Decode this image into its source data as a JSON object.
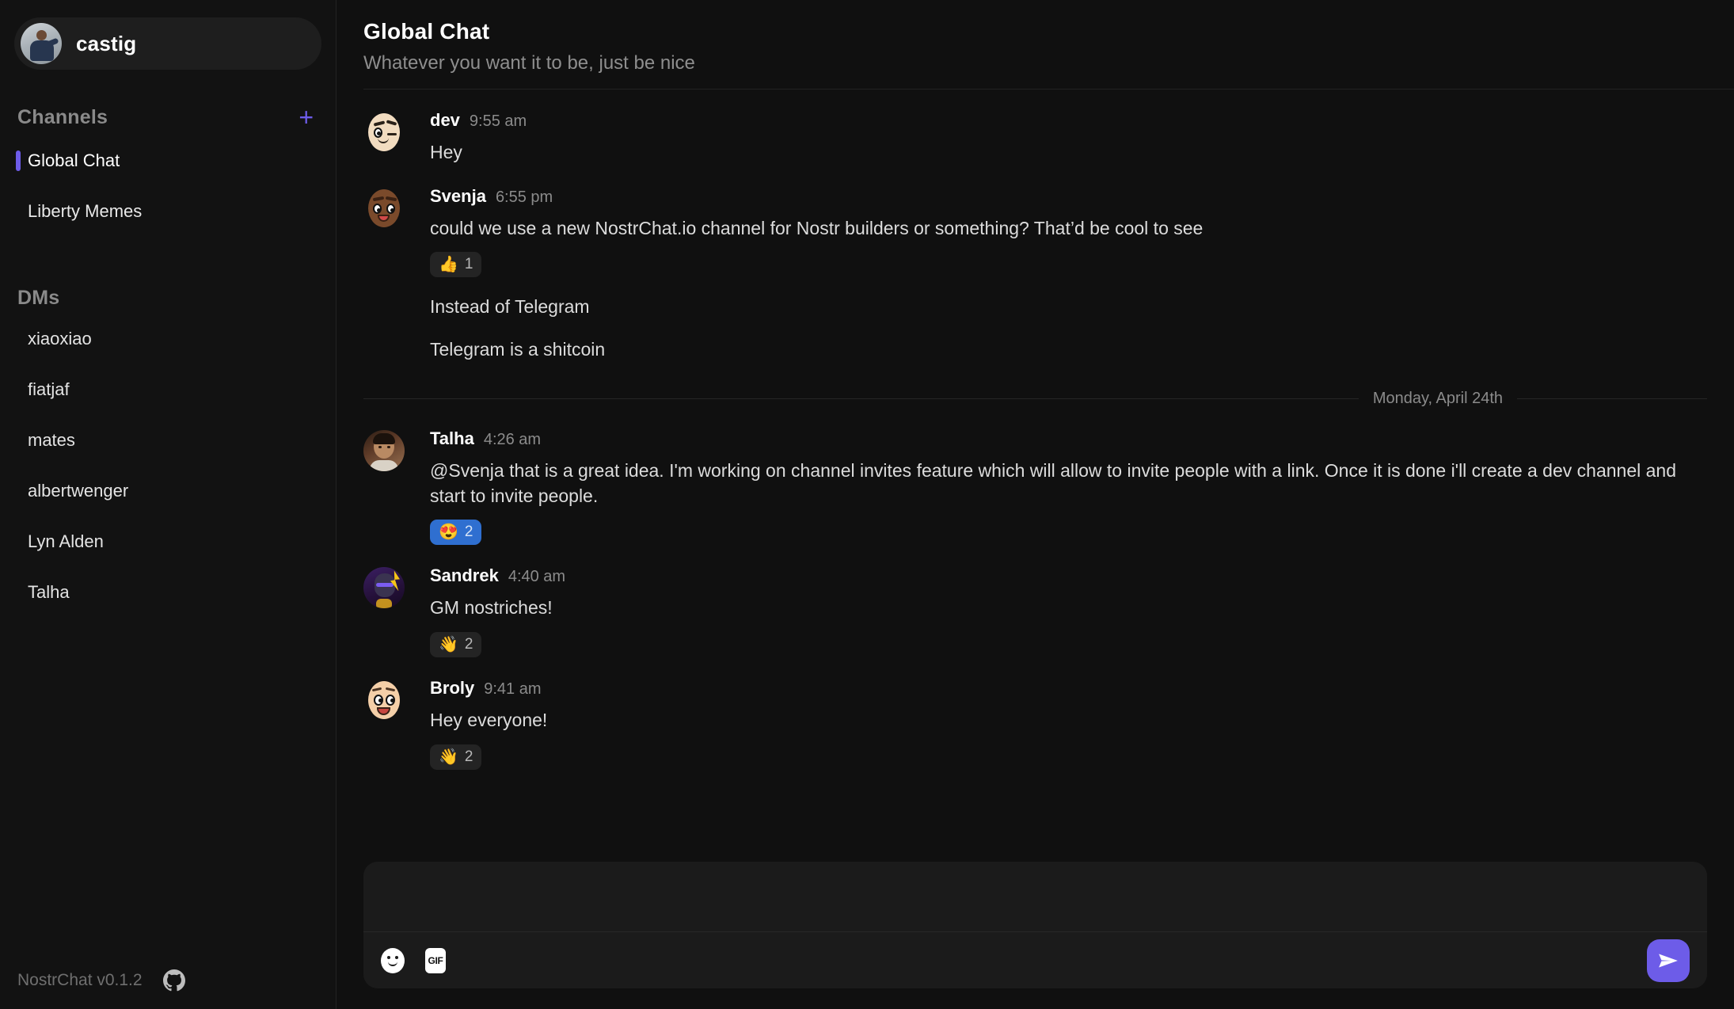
{
  "app": {
    "version_label": "NostrChat v0.1.2",
    "github_icon": "github-icon"
  },
  "sidebar": {
    "profile": {
      "name": "castig",
      "avatar": "user-avatar"
    },
    "channels_section": {
      "title": "Channels",
      "add_label": "+"
    },
    "channels": [
      {
        "label": "Global Chat",
        "active": true
      },
      {
        "label": "Liberty Memes",
        "active": false
      }
    ],
    "dms_section": {
      "title": "DMs"
    },
    "dms": [
      {
        "label": "xiaoxiao"
      },
      {
        "label": "fiatjaf"
      },
      {
        "label": "mates"
      },
      {
        "label": "albertwenger"
      },
      {
        "label": "Lyn Alden"
      },
      {
        "label": "Talha"
      }
    ]
  },
  "header": {
    "title": "Global Chat",
    "subtitle": "Whatever you want it to be, just be nice"
  },
  "messages": [
    {
      "author": "dev",
      "time": "9:55 am",
      "lines": [
        "Hey"
      ],
      "reactions": []
    },
    {
      "author": "Svenja",
      "time": "6:55 pm",
      "lines": [
        "could we use a new NostrChat.io channel for Nostr builders or something? That’d be cool to see",
        "Instead of Telegram",
        "Telegram is a shitcoin"
      ],
      "reactions": [
        {
          "emoji": "👍",
          "count": "1",
          "mine": false,
          "after_line": 0
        }
      ]
    },
    {
      "author": "Talha",
      "time": "4:26 am",
      "lines": [
        "@Svenja that is a great idea. I'm working on channel invites feature which will allow to invite people with a link. Once it is done i'll create a dev channel and start to invite people."
      ],
      "reactions": [
        {
          "emoji": "😍",
          "count": "2",
          "mine": true,
          "after_line": 0
        }
      ]
    },
    {
      "author": "Sandrek",
      "time": "4:40 am",
      "lines": [
        "GM nostriches!"
      ],
      "reactions": [
        {
          "emoji": "👋",
          "count": "2",
          "mine": false,
          "after_line": 0
        }
      ]
    },
    {
      "author": "Broly",
      "time": "9:41 am",
      "lines": [
        "Hey everyone!"
      ],
      "reactions": [
        {
          "emoji": "👋",
          "count": "2",
          "mine": false,
          "after_line": 0
        }
      ]
    }
  ],
  "date_divider": {
    "label": "Monday, April 24th"
  },
  "composer": {
    "placeholder": "",
    "value": "",
    "emoji_icon": "emoji-smiley-icon",
    "gif_label": "GIF",
    "send_icon": "send-paper-plane-icon"
  },
  "colors": {
    "accent": "#6d5ce8",
    "reaction_active": "#2f6fd0",
    "sidebar_bg": "#121212",
    "main_bg": "#101010"
  }
}
